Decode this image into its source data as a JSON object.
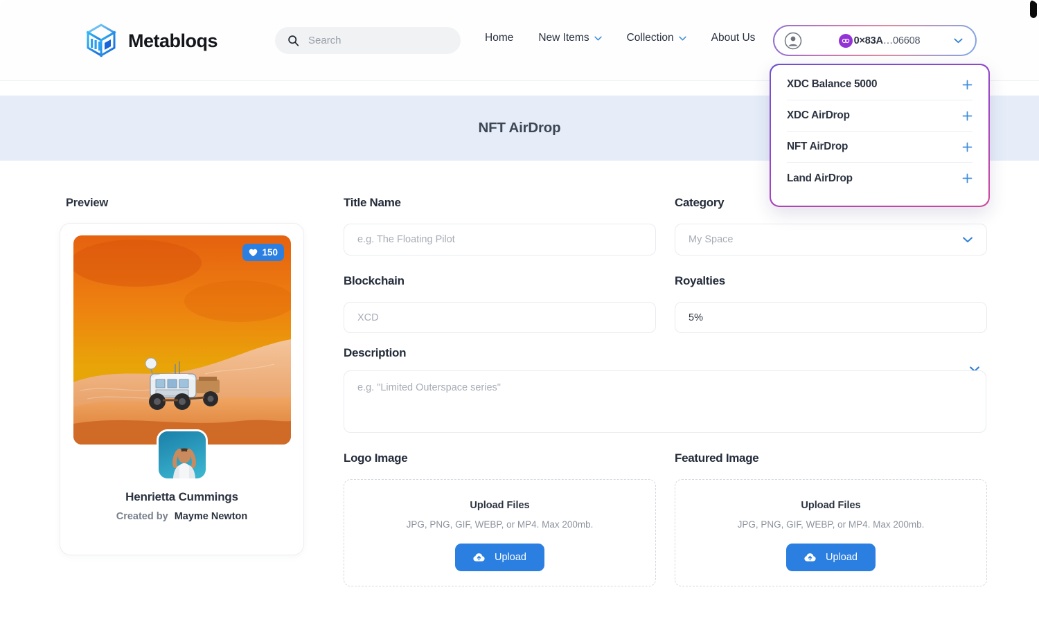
{
  "header": {
    "logo_icon": "cube-logo-icon",
    "brand": "Metabloqs",
    "search": {
      "placeholder": "Search",
      "value": "",
      "icon": "search-icon"
    },
    "nav": [
      {
        "label": "Home",
        "caret": false
      },
      {
        "label": "New Items",
        "caret": true
      },
      {
        "label": "Collection",
        "caret": true
      },
      {
        "label": "About Us",
        "caret": false
      }
    ],
    "wallet": {
      "avatar_icon": "user-circle-icon",
      "badge_icon": "chain-loop-icon",
      "address_prefix": "0×83A",
      "address_suffix": "…06608",
      "chevron_icon": "chevron-down-icon"
    }
  },
  "dropdown": {
    "items": [
      {
        "label": "XDC Balance 5000",
        "action_icon": "plus-icon"
      },
      {
        "label": "XDC AirDrop",
        "action_icon": "plus-icon"
      },
      {
        "label": "NFT AirDrop",
        "action_icon": "plus-icon"
      },
      {
        "label": "Land AirDrop",
        "action_icon": "plus-icon"
      }
    ]
  },
  "banner": {
    "title": "NFT AirDrop"
  },
  "preview": {
    "label": "Preview",
    "like_count": "150",
    "like_icon": "heart-icon",
    "nft_name": "Henrietta Cummings",
    "created_by_label": "Created by",
    "creator_name": "Mayme Newton"
  },
  "form": {
    "title_name": {
      "label": "Title Name",
      "placeholder": "e.g. The Floating Pilot",
      "value": ""
    },
    "category": {
      "label": "Category",
      "placeholder": "My Space",
      "value": "",
      "chevron_icon": "chevron-down-icon"
    },
    "blockchain": {
      "label": "Blockchain",
      "placeholder": "XCD",
      "value": ""
    },
    "royalties": {
      "label": "Royalties",
      "placeholder": "",
      "value": "5%"
    },
    "description": {
      "label": "Description",
      "placeholder": "e.g. \"Limited Outerspace series\"",
      "value": "",
      "chevron_icon": "chevron-down-icon"
    }
  },
  "uploads": [
    {
      "label": "Logo Image",
      "title": "Upload Files",
      "hint": "JPG, PNG, GIF, WEBP, or MP4. Max 200mb.",
      "button": "Upload",
      "button_icon": "cloud-upload-icon"
    },
    {
      "label": "Featured Image",
      "title": "Upload Files",
      "hint": "JPG, PNG, GIF, WEBP, or MP4. Max 200mb.",
      "button": "Upload",
      "button_icon": "cloud-upload-icon"
    }
  ],
  "colors": {
    "accent_blue": "#2b7fe0",
    "banner_bg": "#e6edf9",
    "badge_purple": "#9333d6",
    "text_dark": "#2b3240"
  }
}
